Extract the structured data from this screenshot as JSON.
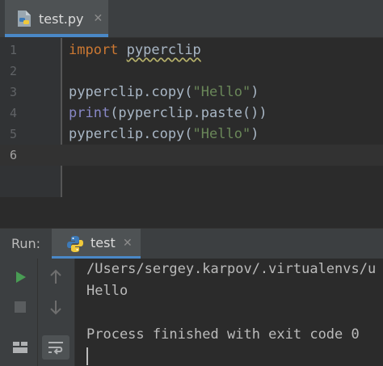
{
  "editor": {
    "tab": {
      "label": "test.py",
      "icon": "python-file-icon",
      "close": "✕"
    },
    "lines": [
      {
        "number": "1",
        "tokens": [
          {
            "t": "import",
            "c": "kw"
          },
          {
            "t": " ",
            "c": ""
          },
          {
            "t": "pyperclip",
            "c": "squiggle"
          }
        ]
      },
      {
        "number": "2",
        "tokens": []
      },
      {
        "number": "3",
        "tokens": [
          {
            "t": "pyperclip.copy(",
            "c": ""
          },
          {
            "t": "\"Hello\"",
            "c": "str"
          },
          {
            "t": ")",
            "c": ""
          }
        ]
      },
      {
        "number": "4",
        "tokens": [
          {
            "t": "print",
            "c": "bi"
          },
          {
            "t": "(pyperclip.paste())",
            "c": ""
          }
        ]
      },
      {
        "number": "5",
        "tokens": [
          {
            "t": "pyperclip.copy(",
            "c": ""
          },
          {
            "t": "\"Hello\"",
            "c": "str"
          },
          {
            "t": ")",
            "c": ""
          }
        ]
      },
      {
        "number": "6",
        "tokens": [],
        "current": true
      }
    ]
  },
  "run": {
    "title": "Run:",
    "tab": {
      "label": "test",
      "icon": "python-icon",
      "close": "✕"
    },
    "toolbar": [
      {
        "icon": "play-icon",
        "enabled": true
      },
      {
        "icon": "arrow-up-icon",
        "enabled": false
      },
      {
        "icon": "stop-icon",
        "enabled": false
      },
      {
        "icon": "arrow-down-icon",
        "enabled": false
      },
      {
        "icon": "layout-icon",
        "enabled": true
      },
      {
        "icon": "soft-wrap-icon",
        "enabled": true
      }
    ],
    "console": {
      "lines": [
        "/Users/sergey.karpov/.virtualenvs/u",
        "Hello",
        "",
        "Process finished with exit code 0"
      ]
    }
  },
  "colors": {
    "keyword": "#cc7832",
    "string": "#6a8759",
    "builtin": "#8888c6",
    "text": "#a9b7c6",
    "accent": "#4a88c7",
    "run_green": "#499c54"
  }
}
